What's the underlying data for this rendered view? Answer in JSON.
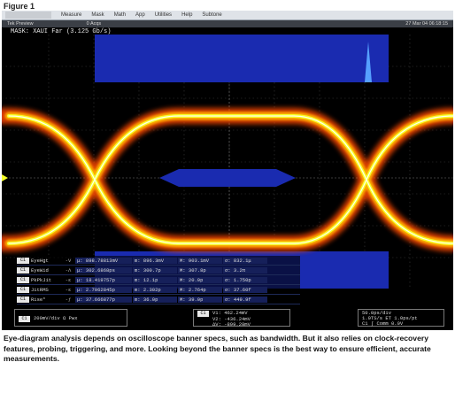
{
  "figure": {
    "label": "Figure 1"
  },
  "menu": {
    "items": [
      "Measure",
      "Mask",
      "Math",
      "App",
      "Utilities",
      "Help",
      "Subtone"
    ]
  },
  "status": {
    "left": "Tek  Preview",
    "acq": "0 Acqs",
    "timestamp": "27 Mar 04 06:18:15"
  },
  "mask": {
    "label": "MASK: XAUI Far (3.125 Gb/s)"
  },
  "measurements": [
    {
      "ch": "C1",
      "name": "EyeHgt",
      "icon": "-V",
      "mean": "μ: 898.78813mV",
      "min": "m: 896.3mV",
      "max": "M: 903.1mV",
      "stdev": "σ: 832.1μ"
    },
    {
      "ch": "C1",
      "name": "EyeWid",
      "icon": "-Λ",
      "mean": "μ: 302.6868ps",
      "min": "m: 300.7p",
      "max": "M: 307.8p",
      "stdev": "σ: 3.2π"
    },
    {
      "ch": "C1",
      "name": "PkPkJit",
      "icon": "-ε",
      "mean": "μ: 18.419757p",
      "min": "m: 12.1p",
      "max": "M: 20.0p",
      "stdev": "σ: 1.750p"
    },
    {
      "ch": "C1",
      "name": "JitRMS",
      "icon": "-ε",
      "mean": "μ: 2.7062845p",
      "min": "m: 2.302p",
      "max": "M: 2.764p",
      "stdev": "σ: 37.60f"
    },
    {
      "ch": "C1",
      "name": "Rise*",
      "icon": "-ƒ",
      "mean": "μ: 37.666877p",
      "min": "m: 36.0p",
      "max": "M: 39.0p",
      "stdev": "σ: 449.9f"
    }
  ],
  "ch_scale": {
    "badge": "C1",
    "value": "200mV/div   Ω Pwx"
  },
  "cursors": {
    "badge": "C1",
    "v1": "V1:  462.24mV",
    "v2": "V2:  -436.24mV",
    "dv": "ΔV:  -899.28mV"
  },
  "timebase": {
    "line1": "50.0ps/div",
    "line2": "1.0TS/s  ET  1.0ps/pt",
    "line3": "C1 ∫  Comm 0.0V"
  },
  "caption": {
    "text": "Eye-diagram analysis depends on oscilloscope banner specs, such as bandwidth. But it also relies on clock-recovery features, probing, triggering, and more. Looking beyond the banner specs is the best way to ensure efficient, accurate measurements."
  },
  "colors": {
    "eye_hot": "#ffffff",
    "eye_core": "#f6ff2a",
    "eye_outer": "#ffb000",
    "eye_edge": "#ff4a00",
    "mask": "#1a2bb0",
    "grid": "#3a3a3a"
  }
}
